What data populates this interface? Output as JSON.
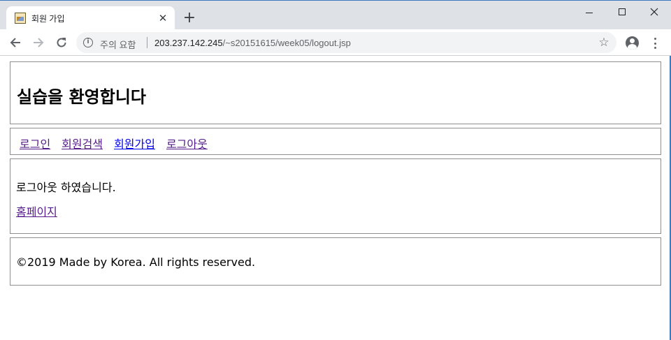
{
  "browser": {
    "tab_title": "회원 가입",
    "tab_close_glyph": "✕",
    "new_tab_glyph": "+",
    "security_label": "주의 요함",
    "url_host": "203.237.142.245",
    "url_path": "/~s20151615/week05/logout.jsp",
    "icons": {
      "back": "arrow-back-icon",
      "forward": "arrow-forward-icon",
      "reload": "reload-icon",
      "info": "info-icon",
      "star": "star-icon",
      "account": "account-icon",
      "menu": "kebab-menu-icon"
    }
  },
  "page": {
    "title": "실습을 환영합니다",
    "nav": [
      {
        "label": "로그인",
        "visited": true
      },
      {
        "label": "회원검색",
        "visited": true
      },
      {
        "label": "회원가입",
        "visited": false
      },
      {
        "label": "로그아웃",
        "visited": true
      }
    ],
    "message": "로그아웃 하였습니다.",
    "home_link": "홈페이지",
    "footer": "©2019 Made by Korea. All rights reserved."
  },
  "colors": {
    "visited_link": "#551a8b",
    "unvisited_link": "#0000ee",
    "box_border": "#8e8e8e",
    "tabbar_bg": "#dee1e6"
  }
}
